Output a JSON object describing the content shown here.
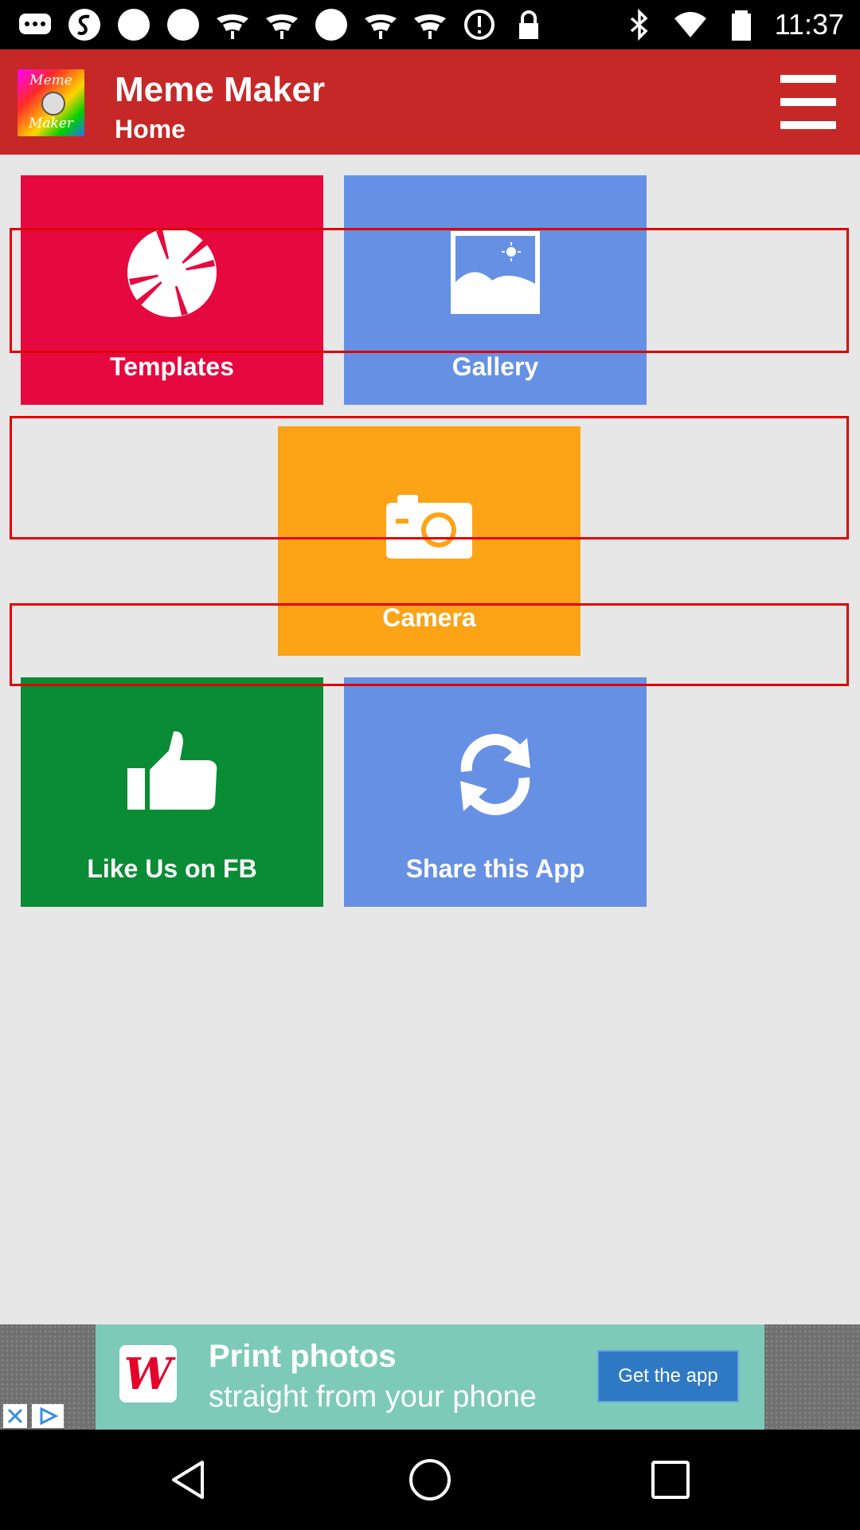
{
  "status_bar": {
    "time": "11:37",
    "left_icons": [
      "chat-icon",
      "s-icon",
      "circle-icon",
      "circle-icon",
      "signal-icon",
      "signal-icon",
      "circle-icon",
      "signal-icon",
      "signal-icon",
      "alert-icon",
      "lock-icon"
    ],
    "right_icons": [
      "bluetooth-icon",
      "wifi-icon",
      "battery-icon"
    ]
  },
  "app_bar": {
    "logo_top": "Meme",
    "logo_bottom": "Maker",
    "title": "Meme Maker",
    "subtitle": "Home",
    "menu_icon": "hamburger-menu-icon",
    "color": "#c62828"
  },
  "tiles": {
    "templates": {
      "label": "Templates",
      "icon": "aperture-icon",
      "color": "#e5093f"
    },
    "gallery": {
      "label": "Gallery",
      "icon": "image-icon",
      "color": "#6690e4"
    },
    "camera": {
      "label": "Camera",
      "icon": "camera-icon",
      "color": "#fda316"
    },
    "fb": {
      "label": "Like Us on FB",
      "icon": "thumbs-up-icon",
      "color": "#098c35"
    },
    "share": {
      "label": "Share this App",
      "icon": "refresh-icon",
      "color": "#6690e4"
    }
  },
  "ad": {
    "logo": "W",
    "line1": "Print photos",
    "line2": "straight from your phone",
    "cta": "Get the app"
  },
  "nav_bar": {
    "icons": [
      "back-icon",
      "home-icon",
      "recents-icon"
    ]
  }
}
